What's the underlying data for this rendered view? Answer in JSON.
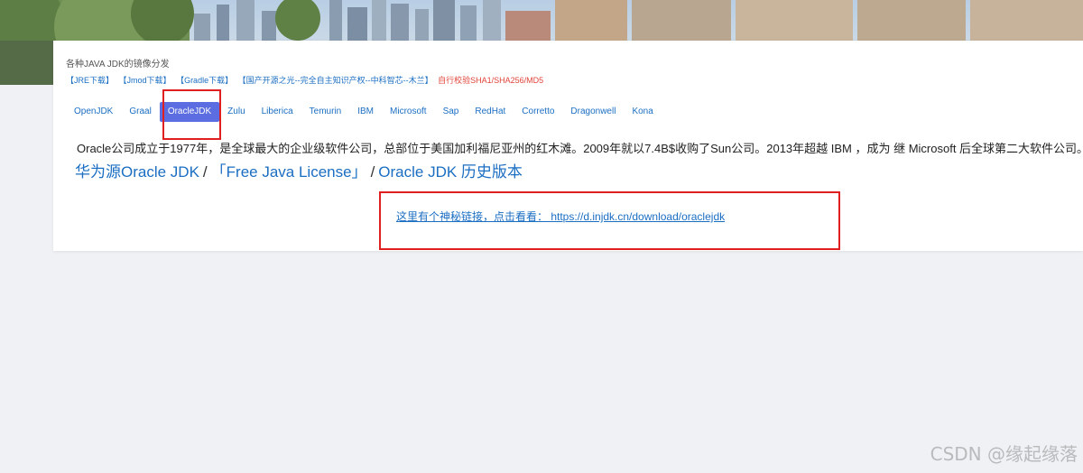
{
  "header": {
    "subtitle": "各种JAVA JDK的镜像分发",
    "links": [
      {
        "label": "【JRE下载】"
      },
      {
        "label": "【Jmod下载】"
      },
      {
        "label": "【Gradle下载】"
      },
      {
        "label": "【国产开源之光--完全自主知识产权--中科智芯--木兰】"
      }
    ],
    "verify_label": "自行校验SHA1/SHA256/MD5",
    "verify_color": "#e0443a"
  },
  "tabs": [
    {
      "label": "OpenJDK",
      "active": false
    },
    {
      "label": "Graal",
      "active": false
    },
    {
      "label": "OracleJDK",
      "active": true
    },
    {
      "label": "Zulu",
      "active": false
    },
    {
      "label": "Liberica",
      "active": false
    },
    {
      "label": "Temurin",
      "active": false
    },
    {
      "label": "IBM",
      "active": false
    },
    {
      "label": "Microsoft",
      "active": false
    },
    {
      "label": "Sap",
      "active": false
    },
    {
      "label": "RedHat",
      "active": false
    },
    {
      "label": "Corretto",
      "active": false
    },
    {
      "label": "Dragonwell",
      "active": false
    },
    {
      "label": "Kona",
      "active": false
    }
  ],
  "main": {
    "description": "Oracle公司成立于1977年，是全球最大的企业级软件公司，总部位于美国加利福尼亚州的红木滩。2009年就以7.4B$收购了Sun公司。2013年超越 IBM ，成为 继 Microsoft 后全球第二大软件公司。",
    "links": [
      {
        "label": "华为源Oracle JDK"
      },
      {
        "label": "「Free Java License」"
      },
      {
        "label": "Oracle JDK 历史版本"
      }
    ],
    "separator": "/",
    "secret_link_text": "这里有个神秘链接，点击看看： https://d.injdk.cn/download/oraclejdk"
  },
  "colors": {
    "link": "#1b6ec2",
    "active_tab_bg": "#5b6de0",
    "annotation_red": "#e02020",
    "page_bg": "#eff1f4"
  },
  "watermark": "CSDN @缘起缘落"
}
